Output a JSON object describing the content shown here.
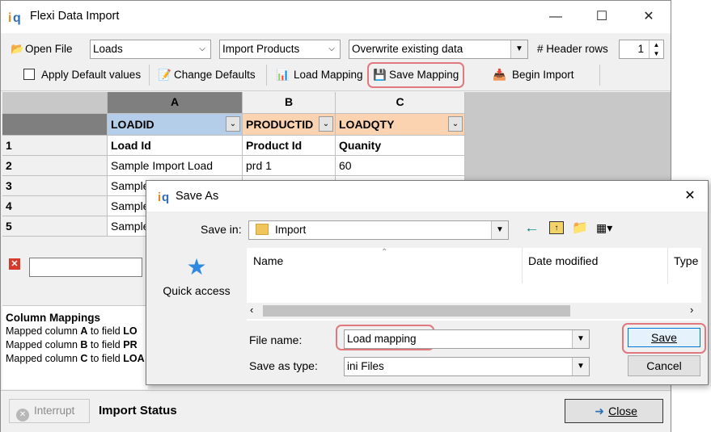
{
  "window": {
    "title": "Flexi Data Import"
  },
  "toolbar": {
    "open_file": "Open File",
    "combo_table": "Loads",
    "combo_profile": "Import Products",
    "combo_mode": "Overwrite existing data",
    "header_rows_label": "# Header rows",
    "header_rows_value": "1",
    "apply_defaults": "Apply Default values",
    "change_defaults": "Change Defaults",
    "load_mapping": "Load Mapping",
    "save_mapping": "Save Mapping",
    "begin_import": "Begin Import"
  },
  "grid": {
    "col_letters": [
      "A",
      "B",
      "C"
    ],
    "field_headers": [
      "LOADID",
      "PRODUCTID",
      "LOADQTY"
    ],
    "rows": [
      {
        "num": "1",
        "cells": [
          "Load Id",
          "Product Id",
          "Quanity"
        ]
      },
      {
        "num": "2",
        "cells": [
          "Sample Import Load",
          "prd 1",
          "60"
        ]
      },
      {
        "num": "3",
        "cells": [
          "Sample",
          "",
          ""
        ]
      },
      {
        "num": "4",
        "cells": [
          "Sample",
          "",
          ""
        ]
      },
      {
        "num": "5",
        "cells": [
          "Sample",
          "",
          ""
        ]
      }
    ]
  },
  "mappings": {
    "title": "Column Mappings",
    "lines": [
      {
        "prefix": "Mapped column ",
        "col": "A",
        "mid": " to field ",
        "field": "LO"
      },
      {
        "prefix": "Mapped column ",
        "col": "B",
        "mid": " to field ",
        "field": "PR"
      },
      {
        "prefix": "Mapped column ",
        "col": "C",
        "mid": " to field ",
        "field": "LOA"
      }
    ]
  },
  "status": {
    "interrupt": "Interrupt",
    "import_status": "Import Status",
    "close": "Close"
  },
  "dialog": {
    "title": "Save As",
    "save_in_label": "Save in:",
    "save_in_value": "Import",
    "quick_access": "Quick access",
    "col_name": "Name",
    "col_date": "Date modified",
    "col_type": "Type",
    "file_name_label": "File name:",
    "file_name_value": "Load mapping",
    "save_type_label": "Save as type:",
    "save_type_value": "ini Files",
    "save_button": "Save",
    "cancel_button": "Cancel"
  },
  "colors": {
    "accent_highlight": "#e0787e",
    "col_a_header": "#b4cde8",
    "field_header": "#fbd3b0",
    "selected_col": "#7f7f7f"
  }
}
